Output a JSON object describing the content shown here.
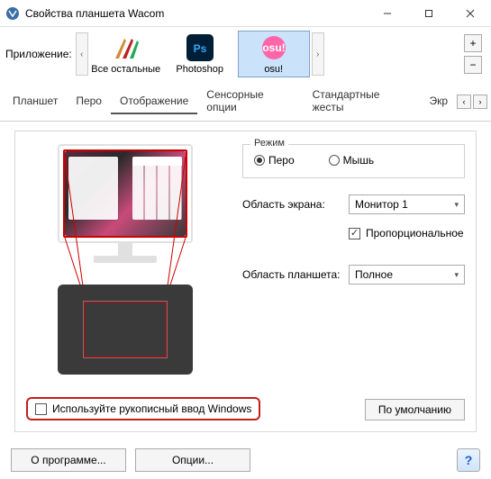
{
  "window": {
    "title": "Свойства планшета Wacom"
  },
  "apps": {
    "label": "Приложение:",
    "items": [
      {
        "name": "Все остальные"
      },
      {
        "name": "Photoshop"
      },
      {
        "name": "osu!"
      }
    ],
    "selected_index": 2
  },
  "tabs": {
    "items": [
      "Планшет",
      "Перо",
      "Отображение",
      "Сенсорные опции",
      "Стандартные жесты",
      "Экр"
    ],
    "active_index": 2
  },
  "mode_group": {
    "legend": "Режим",
    "options": {
      "pen": "Перо",
      "mouse": "Мышь"
    },
    "selected": "pen"
  },
  "screen_area": {
    "label": "Область экрана:",
    "value": "Монитор 1"
  },
  "proportional": {
    "label": "Пропорциональное",
    "checked": true
  },
  "tablet_area": {
    "label": "Область планшета:",
    "value": "Полное"
  },
  "ink_checkbox": {
    "label": "Используйте рукописный ввод Windows",
    "checked": false
  },
  "buttons": {
    "default": "По умолчанию",
    "about": "О программе...",
    "options": "Опции...",
    "help": "?"
  },
  "side_buttons": {
    "plus": "+",
    "minus": "−"
  },
  "colors": {
    "accent_blue": "#7da2ce",
    "highlight_red": "#c41e1e"
  }
}
